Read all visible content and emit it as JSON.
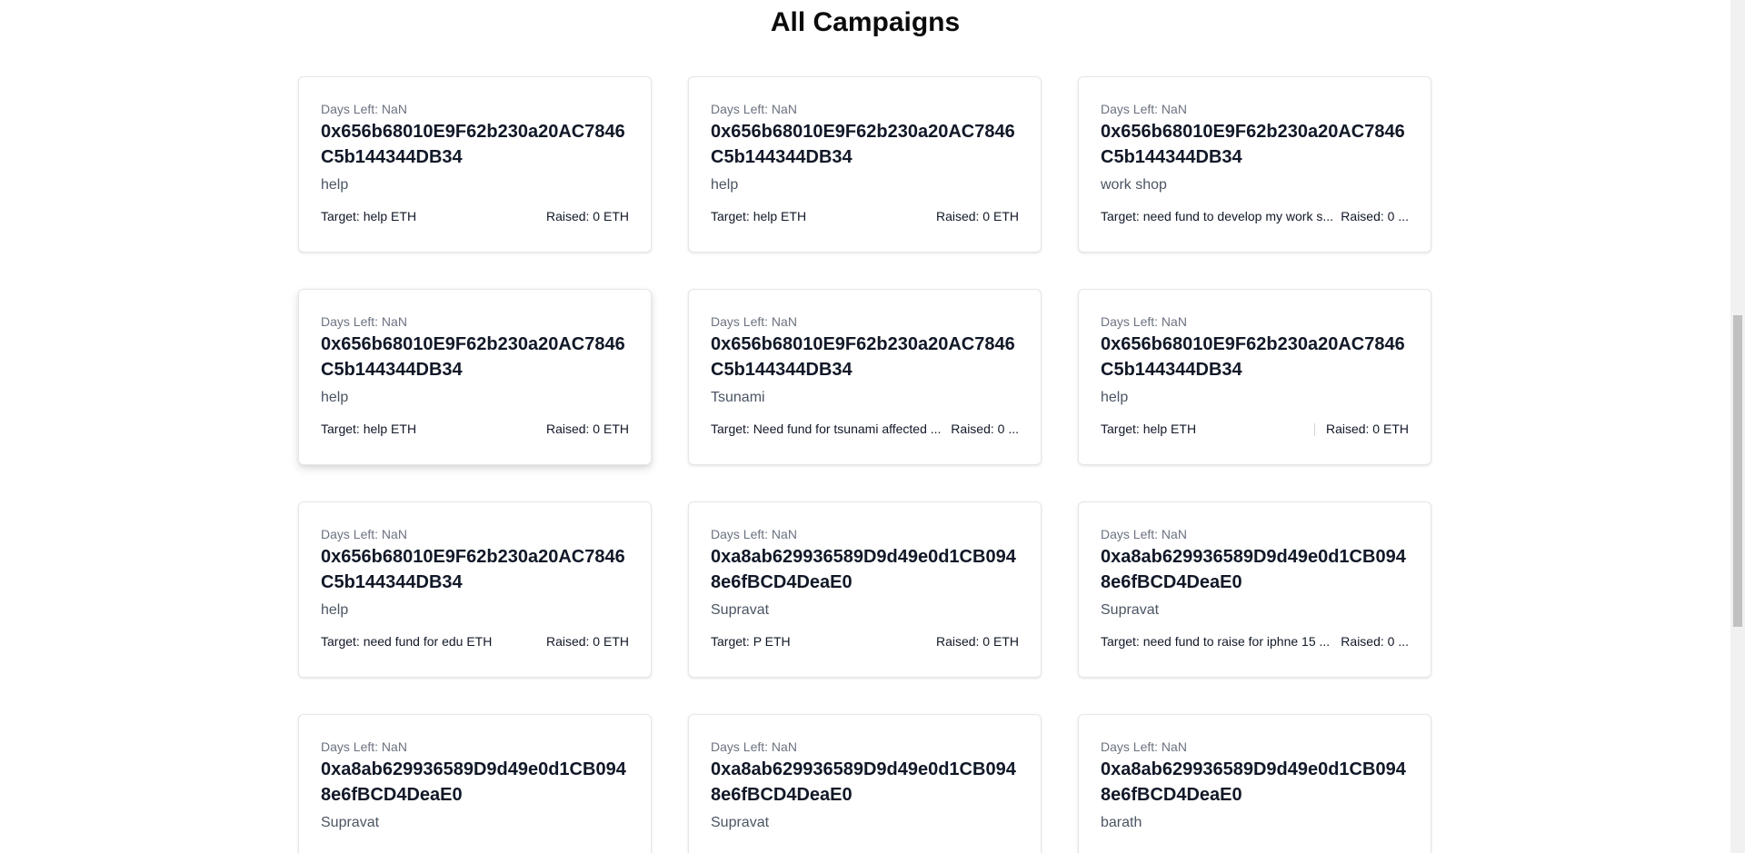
{
  "page": {
    "title": "All Campaigns"
  },
  "campaigns": [
    {
      "days_left": "Days Left: NaN",
      "owner": "0x656b68010E9F62b230a20AC7846C5b144344DB34",
      "title": "help",
      "target": "Target: help ETH",
      "raised": "Raised: 0 ETH"
    },
    {
      "days_left": "Days Left: NaN",
      "owner": "0x656b68010E9F62b230a20AC7846C5b144344DB34",
      "title": "help",
      "target": "Target: help ETH",
      "raised": "Raised: 0 ETH"
    },
    {
      "days_left": "Days Left: NaN",
      "owner": "0x656b68010E9F62b230a20AC7846C5b144344DB34",
      "title": "work shop",
      "target": "Target: need fund to develop my work s...",
      "raised": "Raised: 0 ..."
    },
    {
      "days_left": "Days Left: NaN",
      "owner": "0x656b68010E9F62b230a20AC7846C5b144344DB34",
      "title": "help",
      "target": "Target: help ETH",
      "raised": "Raised: 0 ETH"
    },
    {
      "days_left": "Days Left: NaN",
      "owner": "0x656b68010E9F62b230a20AC7846C5b144344DB34",
      "title": "Tsunami",
      "target": "Target: Need fund for tsunami affected ...",
      "raised": "Raised: 0 ..."
    },
    {
      "days_left": "Days Left: NaN",
      "owner": "0x656b68010E9F62b230a20AC7846C5b144344DB34",
      "title": "help",
      "target": "Target: help ETH",
      "raised": "Raised: 0 ETH"
    },
    {
      "days_left": "Days Left: NaN",
      "owner": "0x656b68010E9F62b230a20AC7846C5b144344DB34",
      "title": "help",
      "target": "Target: need fund for edu ETH",
      "raised": "Raised: 0 ETH"
    },
    {
      "days_left": "Days Left: NaN",
      "owner": "0xa8ab629936589D9d49e0d1CB0948e6fBCD4DeaE0",
      "title": "Supravat",
      "target": "Target: P ETH",
      "raised": "Raised: 0 ETH"
    },
    {
      "days_left": "Days Left: NaN",
      "owner": "0xa8ab629936589D9d49e0d1CB0948e6fBCD4DeaE0",
      "title": "Supravat",
      "target": "Target: need fund to raise for iphne 15 ...",
      "raised": "Raised: 0 ..."
    },
    {
      "days_left": "Days Left: NaN",
      "owner": "0xa8ab629936589D9d49e0d1CB0948e6fBCD4DeaE0",
      "title": "Supravat",
      "target": "",
      "raised": ""
    },
    {
      "days_left": "Days Left: NaN",
      "owner": "0xa8ab629936589D9d49e0d1CB0948e6fBCD4DeaE0",
      "title": "Supravat",
      "target": "",
      "raised": ""
    },
    {
      "days_left": "Days Left: NaN",
      "owner": "0xa8ab629936589D9d49e0d1CB0948e6fBCD4DeaE0",
      "title": "barath",
      "target": "",
      "raised": ""
    }
  ]
}
